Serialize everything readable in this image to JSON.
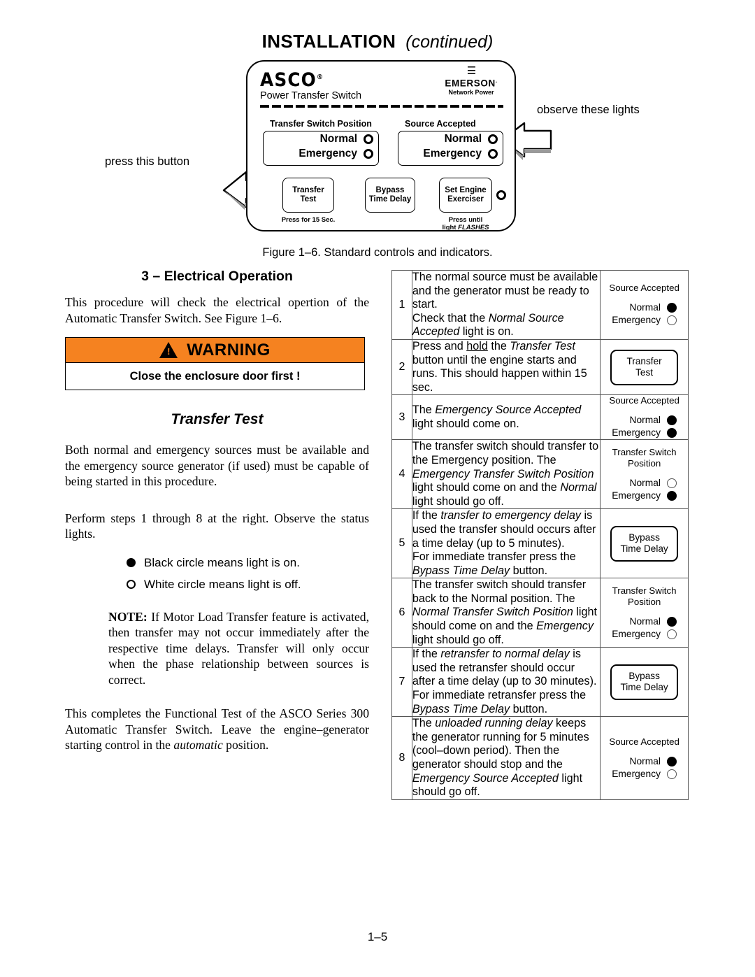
{
  "page": {
    "title_main": "INSTALLATION",
    "title_cont": "(continued)",
    "footer": "1–5"
  },
  "figure": {
    "caption": "Figure 1–6.  Standard controls and indicators.",
    "callout_left": "press this button",
    "callout_right": "observe these lights",
    "brand": {
      "name": "ASCO",
      "registered": "®",
      "tagline": "Power Transfer Switch",
      "partner_name": "EMERSON",
      "partner_tm": ".",
      "partner_sub": "Network Power"
    },
    "groups": [
      {
        "label": "Transfer Switch Position",
        "rows": [
          {
            "label": "Normal",
            "state": "off"
          },
          {
            "label": "Emergency",
            "state": "off"
          }
        ]
      },
      {
        "label": "Source Accepted",
        "rows": [
          {
            "label": "Normal",
            "state": "off"
          },
          {
            "label": "Emergency",
            "state": "off"
          }
        ]
      }
    ],
    "buttons": [
      {
        "line1": "Transfer",
        "line2": "Test",
        "caption1": "Press for 15 Sec.",
        "caption2": ""
      },
      {
        "line1": "Bypass",
        "line2": "Time Delay",
        "caption1": "",
        "caption2": ""
      },
      {
        "line1": "Set Engine",
        "line2": "Exerciser",
        "caption1": "Press until",
        "caption2": "light",
        "caption2_italic": "FLASHES"
      }
    ]
  },
  "left": {
    "section_heading": "3 – Electrical Operation",
    "intro": "This procedure will check the electrical opertion of the Automatic Transfer Switch. See Figure 1–6.",
    "warning": {
      "word": "WARNING",
      "body": "Close the enclosure door first !",
      "color": "#F58220"
    },
    "transfer_test_heading": "Transfer Test",
    "para_sources": "Both normal and emergency sources must be available and the emergency source generator (if used) must be capable of being started in this procedure.",
    "para_perform": "Perform steps 1 through 8 at the right.  Observe the status lights.",
    "legend": [
      {
        "state": "on",
        "text": "Black circle means light is on."
      },
      {
        "state": "off",
        "text": "White circle means light is off."
      }
    ],
    "note_label": "NOTE:",
    "note_text": " If Motor Load Transfer feature is activated, then transfer may not occur immediately after the respective time delays.  Transfer will only occur when the phase relationship between sources is correct.",
    "para_complete_1": "This completes the Functional Test of the ASCO Series 300 Automatic Transfer Switch.  Leave the engine–generator starting control in the ",
    "para_complete_italic": "automatic",
    "para_complete_2": " position."
  },
  "steps": [
    {
      "num": "1",
      "text_html": "The normal source must be available and the generator must be ready to start.<br>Check that the <i>Normal Source Accepted</i> light is on.",
      "indicator": {
        "kind": "lights",
        "title": "Source Accepted",
        "rows": [
          {
            "label": "Normal",
            "state": "on"
          },
          {
            "label": "Emergency",
            "state": "off"
          }
        ]
      }
    },
    {
      "num": "2",
      "text_html": "Press and <u>hold</u> the <i>Transfer Test</i> button until the engine starts and runs. This should happen within 15 sec.",
      "indicator": {
        "kind": "button",
        "line1": "Transfer",
        "line2": "Test"
      }
    },
    {
      "num": "3",
      "text_html": "The <i>Emergency Source Accepted</i> light should come on.",
      "indicator": {
        "kind": "lights",
        "title": "Source Accepted",
        "rows": [
          {
            "label": "Normal",
            "state": "on"
          },
          {
            "label": "Emergency",
            "state": "on"
          }
        ]
      }
    },
    {
      "num": "4",
      "text_html": "The transfer switch should transfer to the Emergency position. The <i>Emergency Transfer Switch Position</i> light should come on and the <i>Normal</i> light should go off.",
      "indicator": {
        "kind": "lights",
        "title": "Transfer Switch Position",
        "rows": [
          {
            "label": "Normal",
            "state": "off"
          },
          {
            "label": "Emergency",
            "state": "on"
          }
        ]
      }
    },
    {
      "num": "5",
      "text_html": "If the <i>transfer to emergency delay</i> is used the transfer should occurs after a time delay (up to 5 minutes).<br>For immediate transfer press the <i>Bypass Time Delay</i> button.",
      "indicator": {
        "kind": "button",
        "line1": "Bypass",
        "line2": "Time Delay"
      }
    },
    {
      "num": "6",
      "text_html": "The transfer switch should transfer back to the Normal position. The <i>Normal Transfer Switch Position</i> light should come on and the <i>Emergency</i> light should go off.",
      "indicator": {
        "kind": "lights",
        "title": "Transfer Switch Position",
        "rows": [
          {
            "label": "Normal",
            "state": "on"
          },
          {
            "label": "Emergency",
            "state": "off"
          }
        ]
      }
    },
    {
      "num": "7",
      "text_html": "If the <i>retransfer to normal delay</i> is used the retransfer should occur after a time delay (up to 30 minutes).<br>For immediate retransfer press the <i>Bypass Time Delay</i> button.",
      "indicator": {
        "kind": "button",
        "line1": "Bypass",
        "line2": "Time Delay"
      }
    },
    {
      "num": "8",
      "text_html": "The <i>unloaded running delay</i> keeps the generator running for 5 minutes (cool–down period). Then the generator should stop and the <i>Emergency Source Accepted</i> light should go off.",
      "indicator": {
        "kind": "lights",
        "title": "Source Accepted",
        "rows": [
          {
            "label": "Normal",
            "state": "on"
          },
          {
            "label": "Emergency",
            "state": "off"
          }
        ]
      }
    }
  ]
}
